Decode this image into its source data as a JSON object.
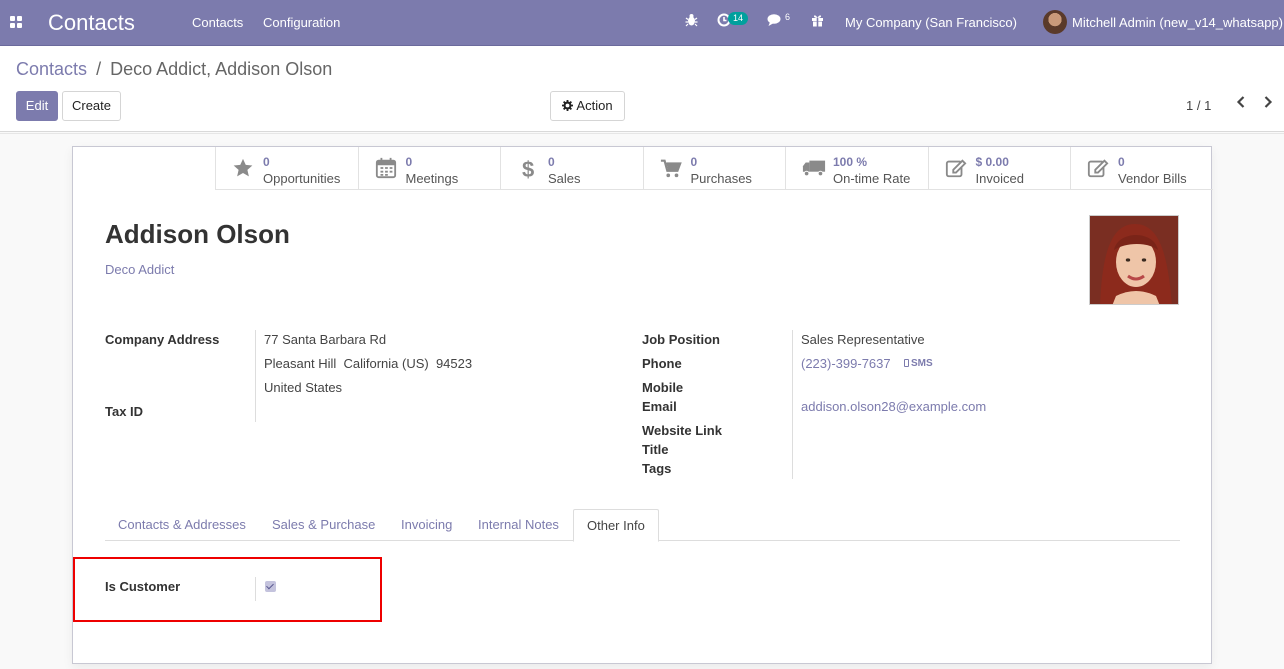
{
  "navbar": {
    "app_title": "Contacts",
    "menu": [
      "Contacts",
      "Configuration"
    ],
    "activity_count": "14",
    "message_count": "6",
    "company": "My Company (San Francisco)",
    "user": "Mitchell Admin (new_v14_whatsapp)"
  },
  "breadcrumb": {
    "parent": "Contacts",
    "separator": "/",
    "current": "Deco Addict, Addison Olson"
  },
  "toolbar": {
    "edit": "Edit",
    "create": "Create",
    "action": "Action"
  },
  "pager": {
    "value": "1 / 1"
  },
  "smart_buttons": [
    {
      "value": "0",
      "label": "Opportunities",
      "icon": "star-icon"
    },
    {
      "value": "0",
      "label": "Meetings",
      "icon": "calendar-icon"
    },
    {
      "value": "0",
      "label": "Sales",
      "icon": "dollar-icon"
    },
    {
      "value": "0",
      "label": "Purchases",
      "icon": "cart-icon"
    },
    {
      "value": "100 %",
      "label": "On-time Rate",
      "icon": "truck-icon"
    },
    {
      "value": "$ 0.00",
      "label": "Invoiced",
      "icon": "edit-icon"
    },
    {
      "value": "0",
      "label": "Vendor Bills",
      "icon": "edit-icon"
    }
  ],
  "contact": {
    "name": "Addison Olson",
    "company": "Deco Addict",
    "address_label": "Company Address",
    "address_lines": [
      "77 Santa Barbara Rd",
      "Pleasant Hill  California (US)  94523",
      "United States"
    ],
    "tax_id_label": "Tax ID",
    "job_position_label": "Job Position",
    "job_position": "Sales Representative",
    "phone_label": "Phone",
    "phone": "(223)-399-7637",
    "sms": "SMS",
    "mobile_label": "Mobile",
    "email_label": "Email",
    "email": "addison.olson28@example.com",
    "website_label": "Website Link",
    "title_label": "Title",
    "tags_label": "Tags"
  },
  "tabs": [
    "Contacts & Addresses",
    "Sales & Purchase",
    "Invoicing",
    "Internal Notes",
    "Other Info"
  ],
  "other_info": {
    "is_customer_label": "Is Customer",
    "is_customer": true
  },
  "colors": {
    "brand": "#7c7bad",
    "highlight": "#ee0000"
  }
}
